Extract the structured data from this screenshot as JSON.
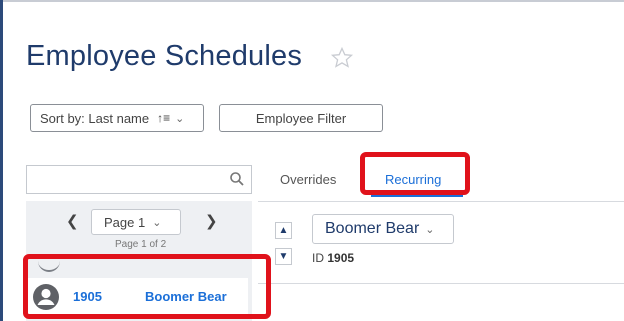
{
  "page": {
    "title": "Employee Schedules"
  },
  "toolbar": {
    "sort_label": "Sort by: Last name",
    "sort_icon": "sort-descending-icon",
    "filter_label": "Employee Filter"
  },
  "search": {
    "placeholder": ""
  },
  "tabs": [
    {
      "label": "Overrides",
      "active": false
    },
    {
      "label": "Recurring",
      "active": true
    }
  ],
  "pager": {
    "current": "Page 1",
    "summary": "Page 1 of 2"
  },
  "employees": [
    {
      "id": "1905",
      "name": "Boomer Bear"
    }
  ],
  "detail": {
    "selected_employee": "Boomer Bear",
    "id_prefix": "ID",
    "id_value": "1905"
  },
  "colors": {
    "title": "#1f3b6b",
    "link": "#1b6fd8",
    "highlight": "#e0121b"
  }
}
